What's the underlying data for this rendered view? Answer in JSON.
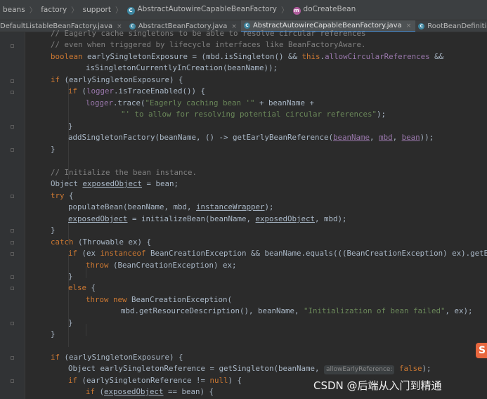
{
  "breadcrumb": {
    "items": [
      "beans",
      "factory",
      "support",
      "AbstractAutowireCapableBeanFactory",
      "doCreateBean"
    ],
    "class_icon_letter": "C",
    "method_icon_letter": "m"
  },
  "tabs": [
    {
      "label": "DefaultListableBeanFactory.java",
      "active": false
    },
    {
      "label": "AbstractBeanFactory.java",
      "active": false
    },
    {
      "label": "AbstractAutowireCapableBeanFactory.java",
      "active": true
    },
    {
      "label": "RootBeanDefinition.java",
      "active": false
    }
  ],
  "tab_close_glyph": "×",
  "code": {
    "l0": "// Eagerly cache singletons to be able to resolve circular references",
    "l1": "// even when triggered by lifecycle interfaces like BeanFactoryAware.",
    "l2a": "boolean",
    "l2b": " earlySingletonExposure = (mbd.isSingleton() && ",
    "l2c": "this",
    "l2d": ".",
    "l2e": "allowCircularReferences",
    "l2f": " &&",
    "l3": "isSingletonCurrentlyInCreation(beanName));",
    "l4a": "if",
    "l4b": " (earlySingletonExposure) {",
    "l5a": "if",
    "l5b": " (",
    "l5c": "logger",
    "l5d": ".isTraceEnabled()) {",
    "l6a": "logger",
    "l6b": ".trace(",
    "l6c": "\"Eagerly caching bean '\"",
    "l6d": " + beanName +",
    "l7a": "\"' to allow for resolving potential circular references\"",
    "l7b": ");",
    "l8": "}",
    "l9a": "addSingletonFactory(beanName, () -> getEarlyBeanReference(",
    "l9b": "beanName",
    "l9c": ", ",
    "l9d": "mbd",
    "l9e": ", ",
    "l9f": "bean",
    "l9g": "));",
    "l10": "}",
    "l11": "// Initialize the bean instance.",
    "l12a": "Object ",
    "l12b": "exposedObject",
    "l12c": " = bean;",
    "l13a": "try",
    "l13b": " {",
    "l14a": "populateBean(beanName, mbd, ",
    "l14b": "instanceWrapper",
    "l14c": ");",
    "l15a": "exposedObject",
    "l15b": " = initializeBean(beanName, ",
    "l15c": "exposedObject",
    "l15d": ", mbd);",
    "l16": "}",
    "l17a": "catch",
    "l17b": " (Throwable ex) {",
    "l18a": "if",
    "l18b": " (ex ",
    "l18c": "instanceof",
    "l18d": " BeanCreationException && beanName.equals(((BeanCreationException) ex).getBeanName",
    "l19a": "throw",
    "l19b": " (BeanCreationException) ex;",
    "l20": "}",
    "l21a": "else",
    "l21b": " {",
    "l22a": "throw new",
    "l22b": " BeanCreationException(",
    "l23a": "mbd.getResourceDescription(), beanName, ",
    "l23b": "\"Initialization of bean failed\"",
    "l23c": ", ex);",
    "l24": "}",
    "l25": "}",
    "l26a": "if",
    "l26b": " (earlySingletonExposure) {",
    "l27a": "Object earlySingletonReference = getSingleton(beanName, ",
    "l27hint": "allowEarlyReference:",
    "l27b": " ",
    "l27c": "false",
    "l27d": ");",
    "l28a": "if",
    "l28b": " (earlySingletonReference != ",
    "l28c": "null",
    "l28d": ") {",
    "l29a": "if",
    "l29b": " (",
    "l29c": "exposedObject",
    "l29d": " == bean) {"
  },
  "watermark": "CSDN @后端从入门到精通",
  "badge": "S",
  "colors": {
    "background": "#2b2b2b",
    "keyword": "#cc7832",
    "comment": "#808080",
    "string": "#6a8759",
    "field": "#9876aa",
    "text": "#a9b7c6"
  }
}
